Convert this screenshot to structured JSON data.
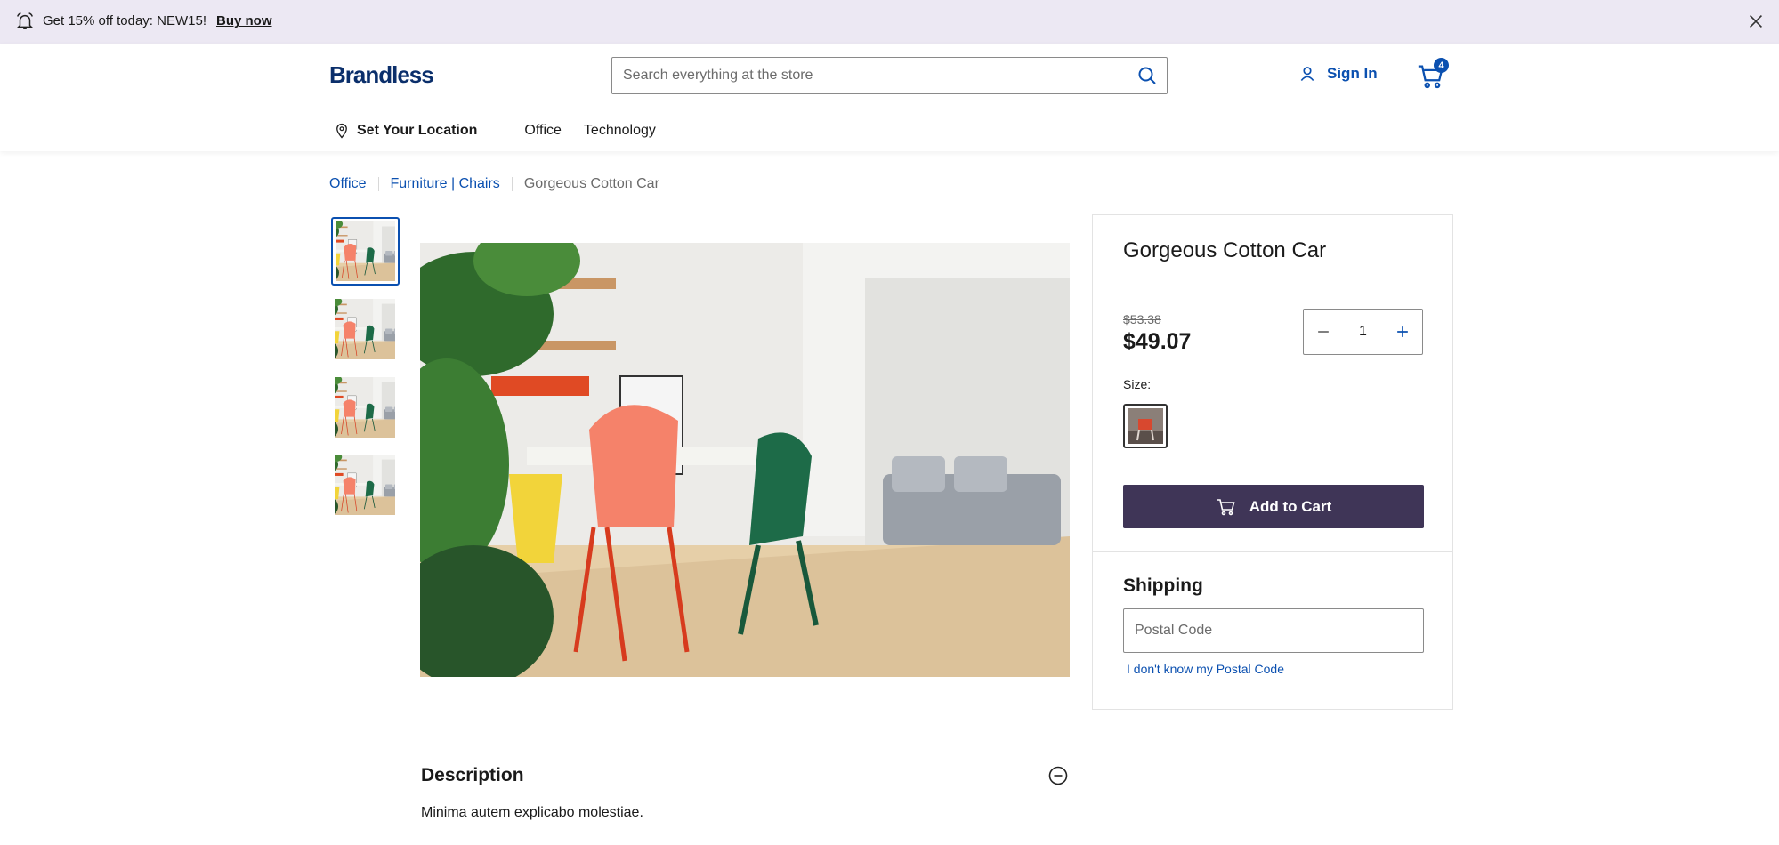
{
  "promo": {
    "message": "Get 15% off today: NEW15!",
    "cta": "Buy now",
    "bell_icon": "bell-icon",
    "close_icon": "close-icon"
  },
  "header": {
    "logo": "Brandless",
    "search_placeholder": "Search everything at the store",
    "sign_in": "Sign In",
    "cart_count": "4",
    "brand_color": "#0b50b0",
    "location_label": "Set Your Location",
    "nav": [
      "Office",
      "Technology"
    ]
  },
  "breadcrumb": {
    "items": [
      "Office",
      "Furniture | Chairs"
    ],
    "current": "Gorgeous Cotton Car"
  },
  "gallery": {
    "thumbnail_count": 4,
    "selected_index": 0
  },
  "product": {
    "title": "Gorgeous Cotton Car",
    "old_price": "$53.38",
    "price": "$49.07",
    "quantity": "1",
    "size_label": "Size:",
    "add_to_cart": "Add to Cart",
    "button_color": "#3f3557"
  },
  "shipping": {
    "title": "Shipping",
    "postal_placeholder": "Postal Code",
    "unknown_link": "I don't know my Postal Code"
  },
  "description": {
    "title": "Description",
    "body": "Minima autem explicabo molestiae."
  }
}
